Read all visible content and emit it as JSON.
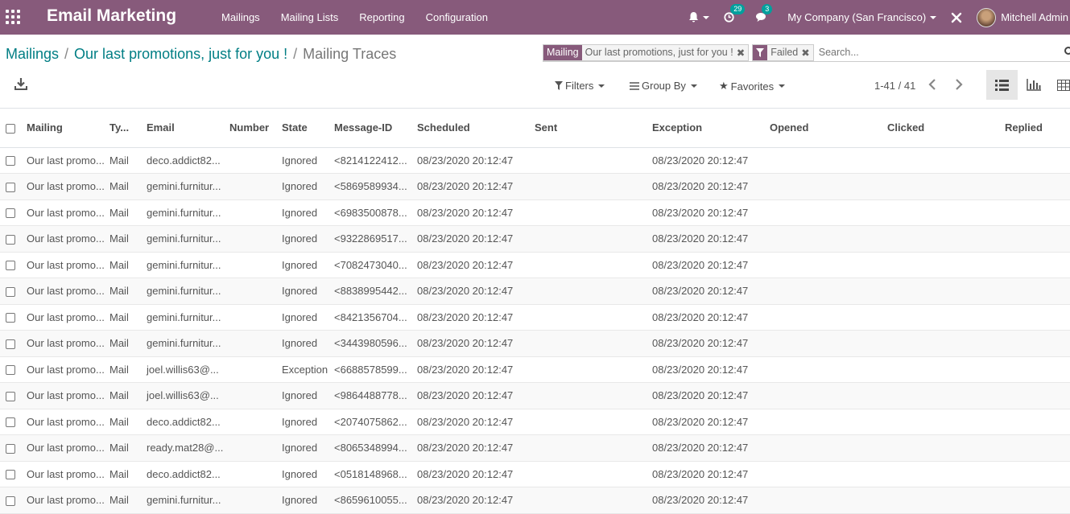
{
  "navbar": {
    "app_title": "Email Marketing",
    "menu": [
      "Mailings",
      "Mailing Lists",
      "Reporting",
      "Configuration"
    ],
    "activity_count": "29",
    "message_count": "3",
    "company": "My Company (San Francisco)",
    "user": "Mitchell Admin",
    "accent_color": "#875a7b"
  },
  "breadcrumb": {
    "root": "Mailings",
    "parent": "Our last promotions, just for you !",
    "current": "Mailing Traces"
  },
  "search": {
    "facets": [
      {
        "title": "Mailing",
        "value": "Our last promotions, just for you !"
      },
      {
        "title": "Failed",
        "value": ""
      }
    ],
    "placeholder": "Search..."
  },
  "controls": {
    "filters": "Filters",
    "group_by": "Group By",
    "favorites": "Favorites",
    "pager": "1-41 / 41"
  },
  "table": {
    "columns": [
      "Mailing",
      "Ty...",
      "Email",
      "Number",
      "State",
      "Message-ID",
      "Scheduled",
      "Sent",
      "Exception",
      "Opened",
      "Clicked",
      "Replied"
    ],
    "rows": [
      [
        "Our last promo...",
        "Mail",
        "deco.addict82...",
        "",
        "Ignored",
        "<8214122412...",
        "08/23/2020 20:12:47",
        "",
        "08/23/2020 20:12:47",
        "",
        "",
        ""
      ],
      [
        "Our last promo...",
        "Mail",
        "gemini.furnitur...",
        "",
        "Ignored",
        "<5869589934...",
        "08/23/2020 20:12:47",
        "",
        "08/23/2020 20:12:47",
        "",
        "",
        ""
      ],
      [
        "Our last promo...",
        "Mail",
        "gemini.furnitur...",
        "",
        "Ignored",
        "<6983500878...",
        "08/23/2020 20:12:47",
        "",
        "08/23/2020 20:12:47",
        "",
        "",
        ""
      ],
      [
        "Our last promo...",
        "Mail",
        "gemini.furnitur...",
        "",
        "Ignored",
        "<9322869517...",
        "08/23/2020 20:12:47",
        "",
        "08/23/2020 20:12:47",
        "",
        "",
        ""
      ],
      [
        "Our last promo...",
        "Mail",
        "gemini.furnitur...",
        "",
        "Ignored",
        "<7082473040...",
        "08/23/2020 20:12:47",
        "",
        "08/23/2020 20:12:47",
        "",
        "",
        ""
      ],
      [
        "Our last promo...",
        "Mail",
        "gemini.furnitur...",
        "",
        "Ignored",
        "<8838995442...",
        "08/23/2020 20:12:47",
        "",
        "08/23/2020 20:12:47",
        "",
        "",
        ""
      ],
      [
        "Our last promo...",
        "Mail",
        "gemini.furnitur...",
        "",
        "Ignored",
        "<8421356704...",
        "08/23/2020 20:12:47",
        "",
        "08/23/2020 20:12:47",
        "",
        "",
        ""
      ],
      [
        "Our last promo...",
        "Mail",
        "gemini.furnitur...",
        "",
        "Ignored",
        "<3443980596...",
        "08/23/2020 20:12:47",
        "",
        "08/23/2020 20:12:47",
        "",
        "",
        ""
      ],
      [
        "Our last promo...",
        "Mail",
        "joel.willis63@...",
        "",
        "Exception",
        "<6688578599...",
        "08/23/2020 20:12:47",
        "",
        "08/23/2020 20:12:47",
        "",
        "",
        ""
      ],
      [
        "Our last promo...",
        "Mail",
        "joel.willis63@...",
        "",
        "Ignored",
        "<9864488778...",
        "08/23/2020 20:12:47",
        "",
        "08/23/2020 20:12:47",
        "",
        "",
        ""
      ],
      [
        "Our last promo...",
        "Mail",
        "deco.addict82...",
        "",
        "Ignored",
        "<2074075862...",
        "08/23/2020 20:12:47",
        "",
        "08/23/2020 20:12:47",
        "",
        "",
        ""
      ],
      [
        "Our last promo...",
        "Mail",
        "ready.mat28@...",
        "",
        "Ignored",
        "<8065348994...",
        "08/23/2020 20:12:47",
        "",
        "08/23/2020 20:12:47",
        "",
        "",
        ""
      ],
      [
        "Our last promo...",
        "Mail",
        "deco.addict82...",
        "",
        "Ignored",
        "<0518148968...",
        "08/23/2020 20:12:47",
        "",
        "08/23/2020 20:12:47",
        "",
        "",
        ""
      ],
      [
        "Our last promo...",
        "Mail",
        "gemini.furnitur...",
        "",
        "Ignored",
        "<8659610055...",
        "08/23/2020 20:12:47",
        "",
        "08/23/2020 20:12:47",
        "",
        "",
        ""
      ]
    ]
  }
}
